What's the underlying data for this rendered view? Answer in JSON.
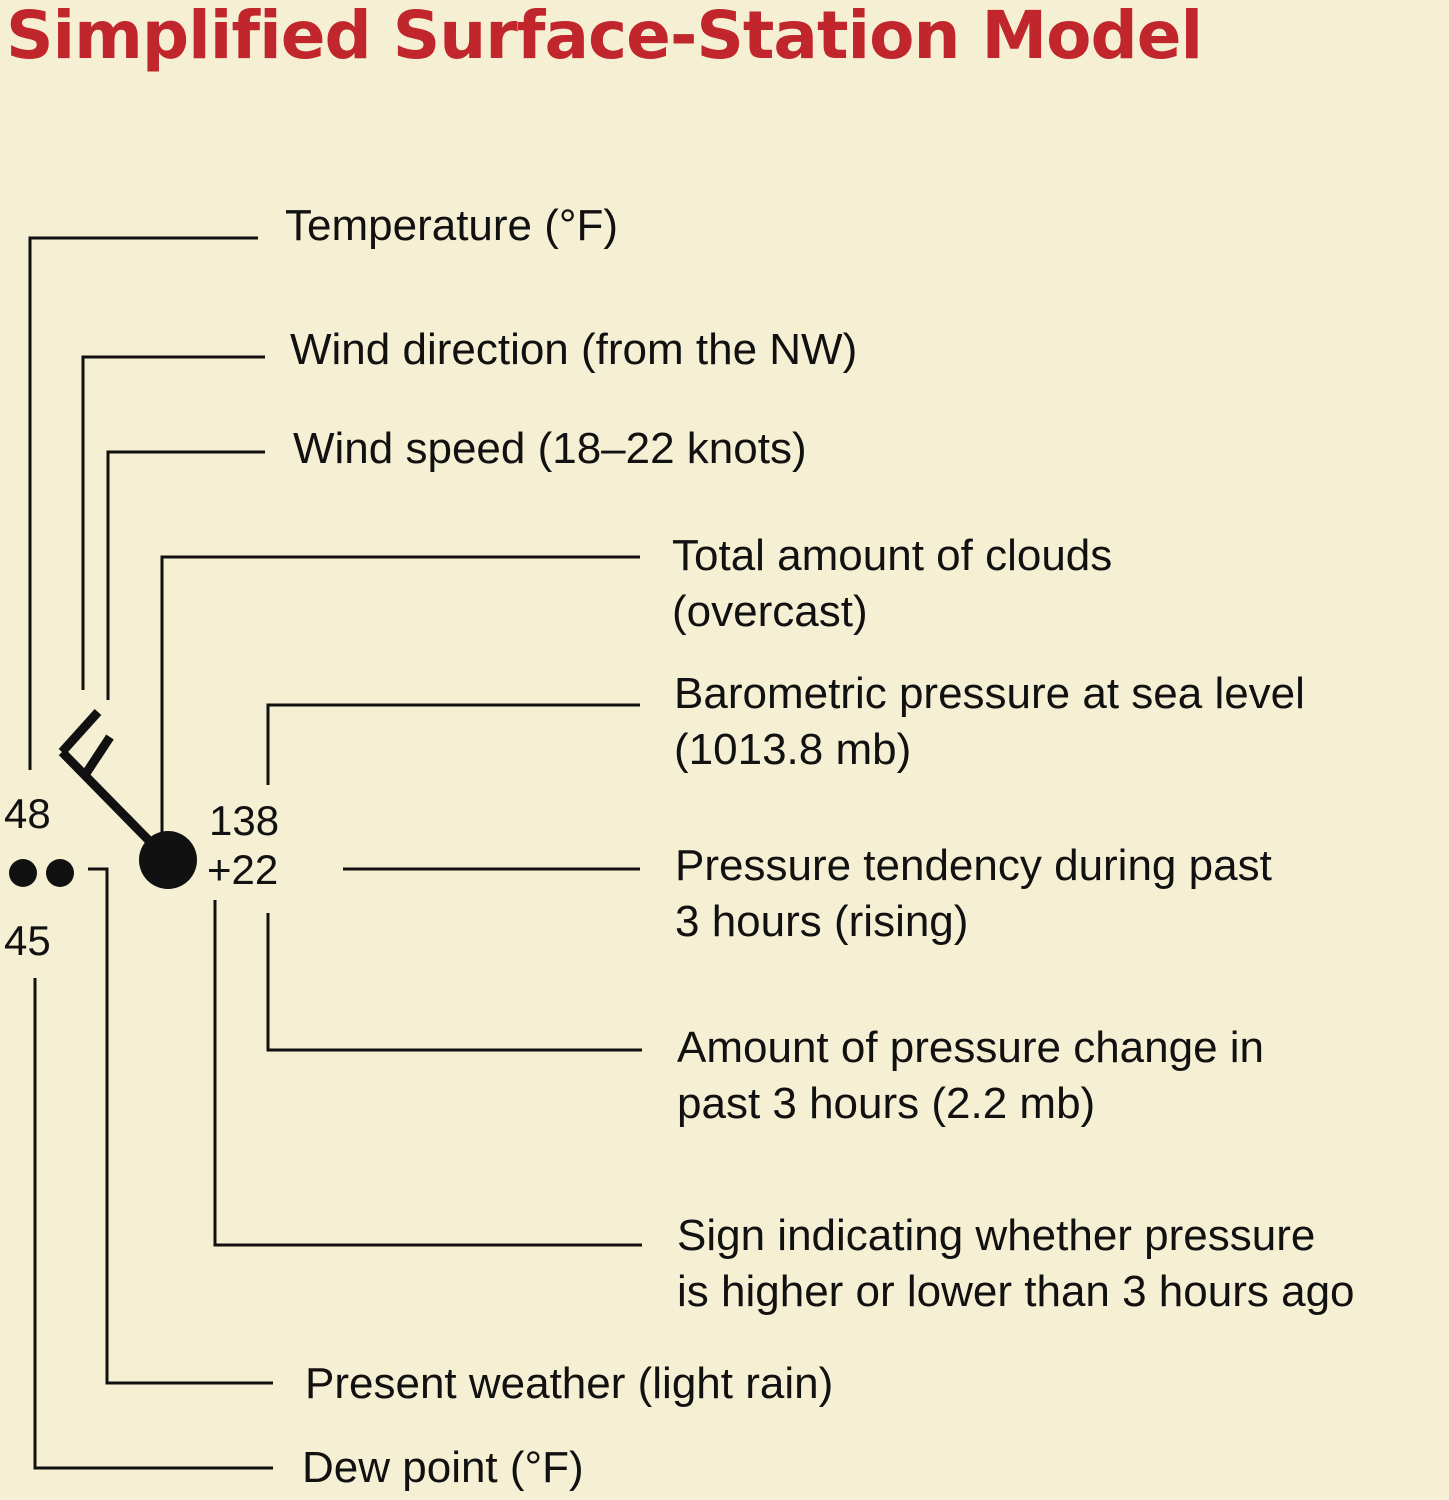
{
  "title": "Simplified Surface-Station Model",
  "station": {
    "temperature": "48",
    "dew_point": "45",
    "pressure": "138",
    "pressure_change": "+22",
    "cloud_cover": "overcast",
    "present_weather_symbol": "two dots (light rain)",
    "wind_barb": "NW, 18–22 knots"
  },
  "labels": {
    "temperature": "Temperature (°F)",
    "wind_direction": "Wind direction (from the NW)",
    "wind_speed": "Wind speed (18–22 knots)",
    "clouds_line1": "Total amount of clouds",
    "clouds_line2": "(overcast)",
    "barometric_line1": "Barometric pressure at sea level",
    "barometric_line2": "(1013.8 mb)",
    "tendency_line1": "Pressure tendency during past",
    "tendency_line2": "3 hours (rising)",
    "change_line1": "Amount of pressure change in",
    "change_line2": "past 3 hours (2.2 mb)",
    "sign_line1": "Sign indicating whether pressure",
    "sign_line2": "is higher or lower than 3 hours ago",
    "present_weather": "Present weather (light rain)",
    "dew_point": "Dew point (°F)"
  },
  "colors": {
    "background": "#f5efd3",
    "title": "#c0262c",
    "ink": "#111111"
  }
}
